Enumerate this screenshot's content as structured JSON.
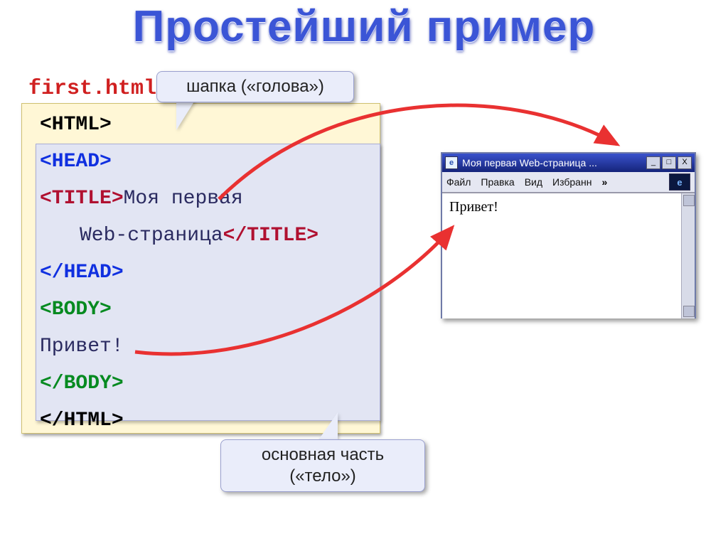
{
  "title": "Простейший пример",
  "filename": "first.html",
  "callouts": {
    "head": "шапка («голова»)",
    "body_line1": "основная часть",
    "body_line2": "(«тело»)"
  },
  "code": {
    "html_open": "<HTML>",
    "head_open": "<HEAD>",
    "title_open": "<TITLE>",
    "title_text1": "Моя первая",
    "title_text2": "Web-страница",
    "title_close": "</TITLE>",
    "head_close": "</HEAD>",
    "body_open": "<BODY>",
    "body_text": "Привет!",
    "body_close": "</BODY>",
    "html_close": "</HTML>"
  },
  "browser": {
    "titlebar": "Моя первая Web-страница ...",
    "minimize": "_",
    "maximize": "□",
    "close": "X",
    "menu": {
      "file": "Файл",
      "edit": "Правка",
      "view": "Вид",
      "favorites": "Избранн",
      "more": "»"
    },
    "logo": "e",
    "content": "Привет!"
  }
}
